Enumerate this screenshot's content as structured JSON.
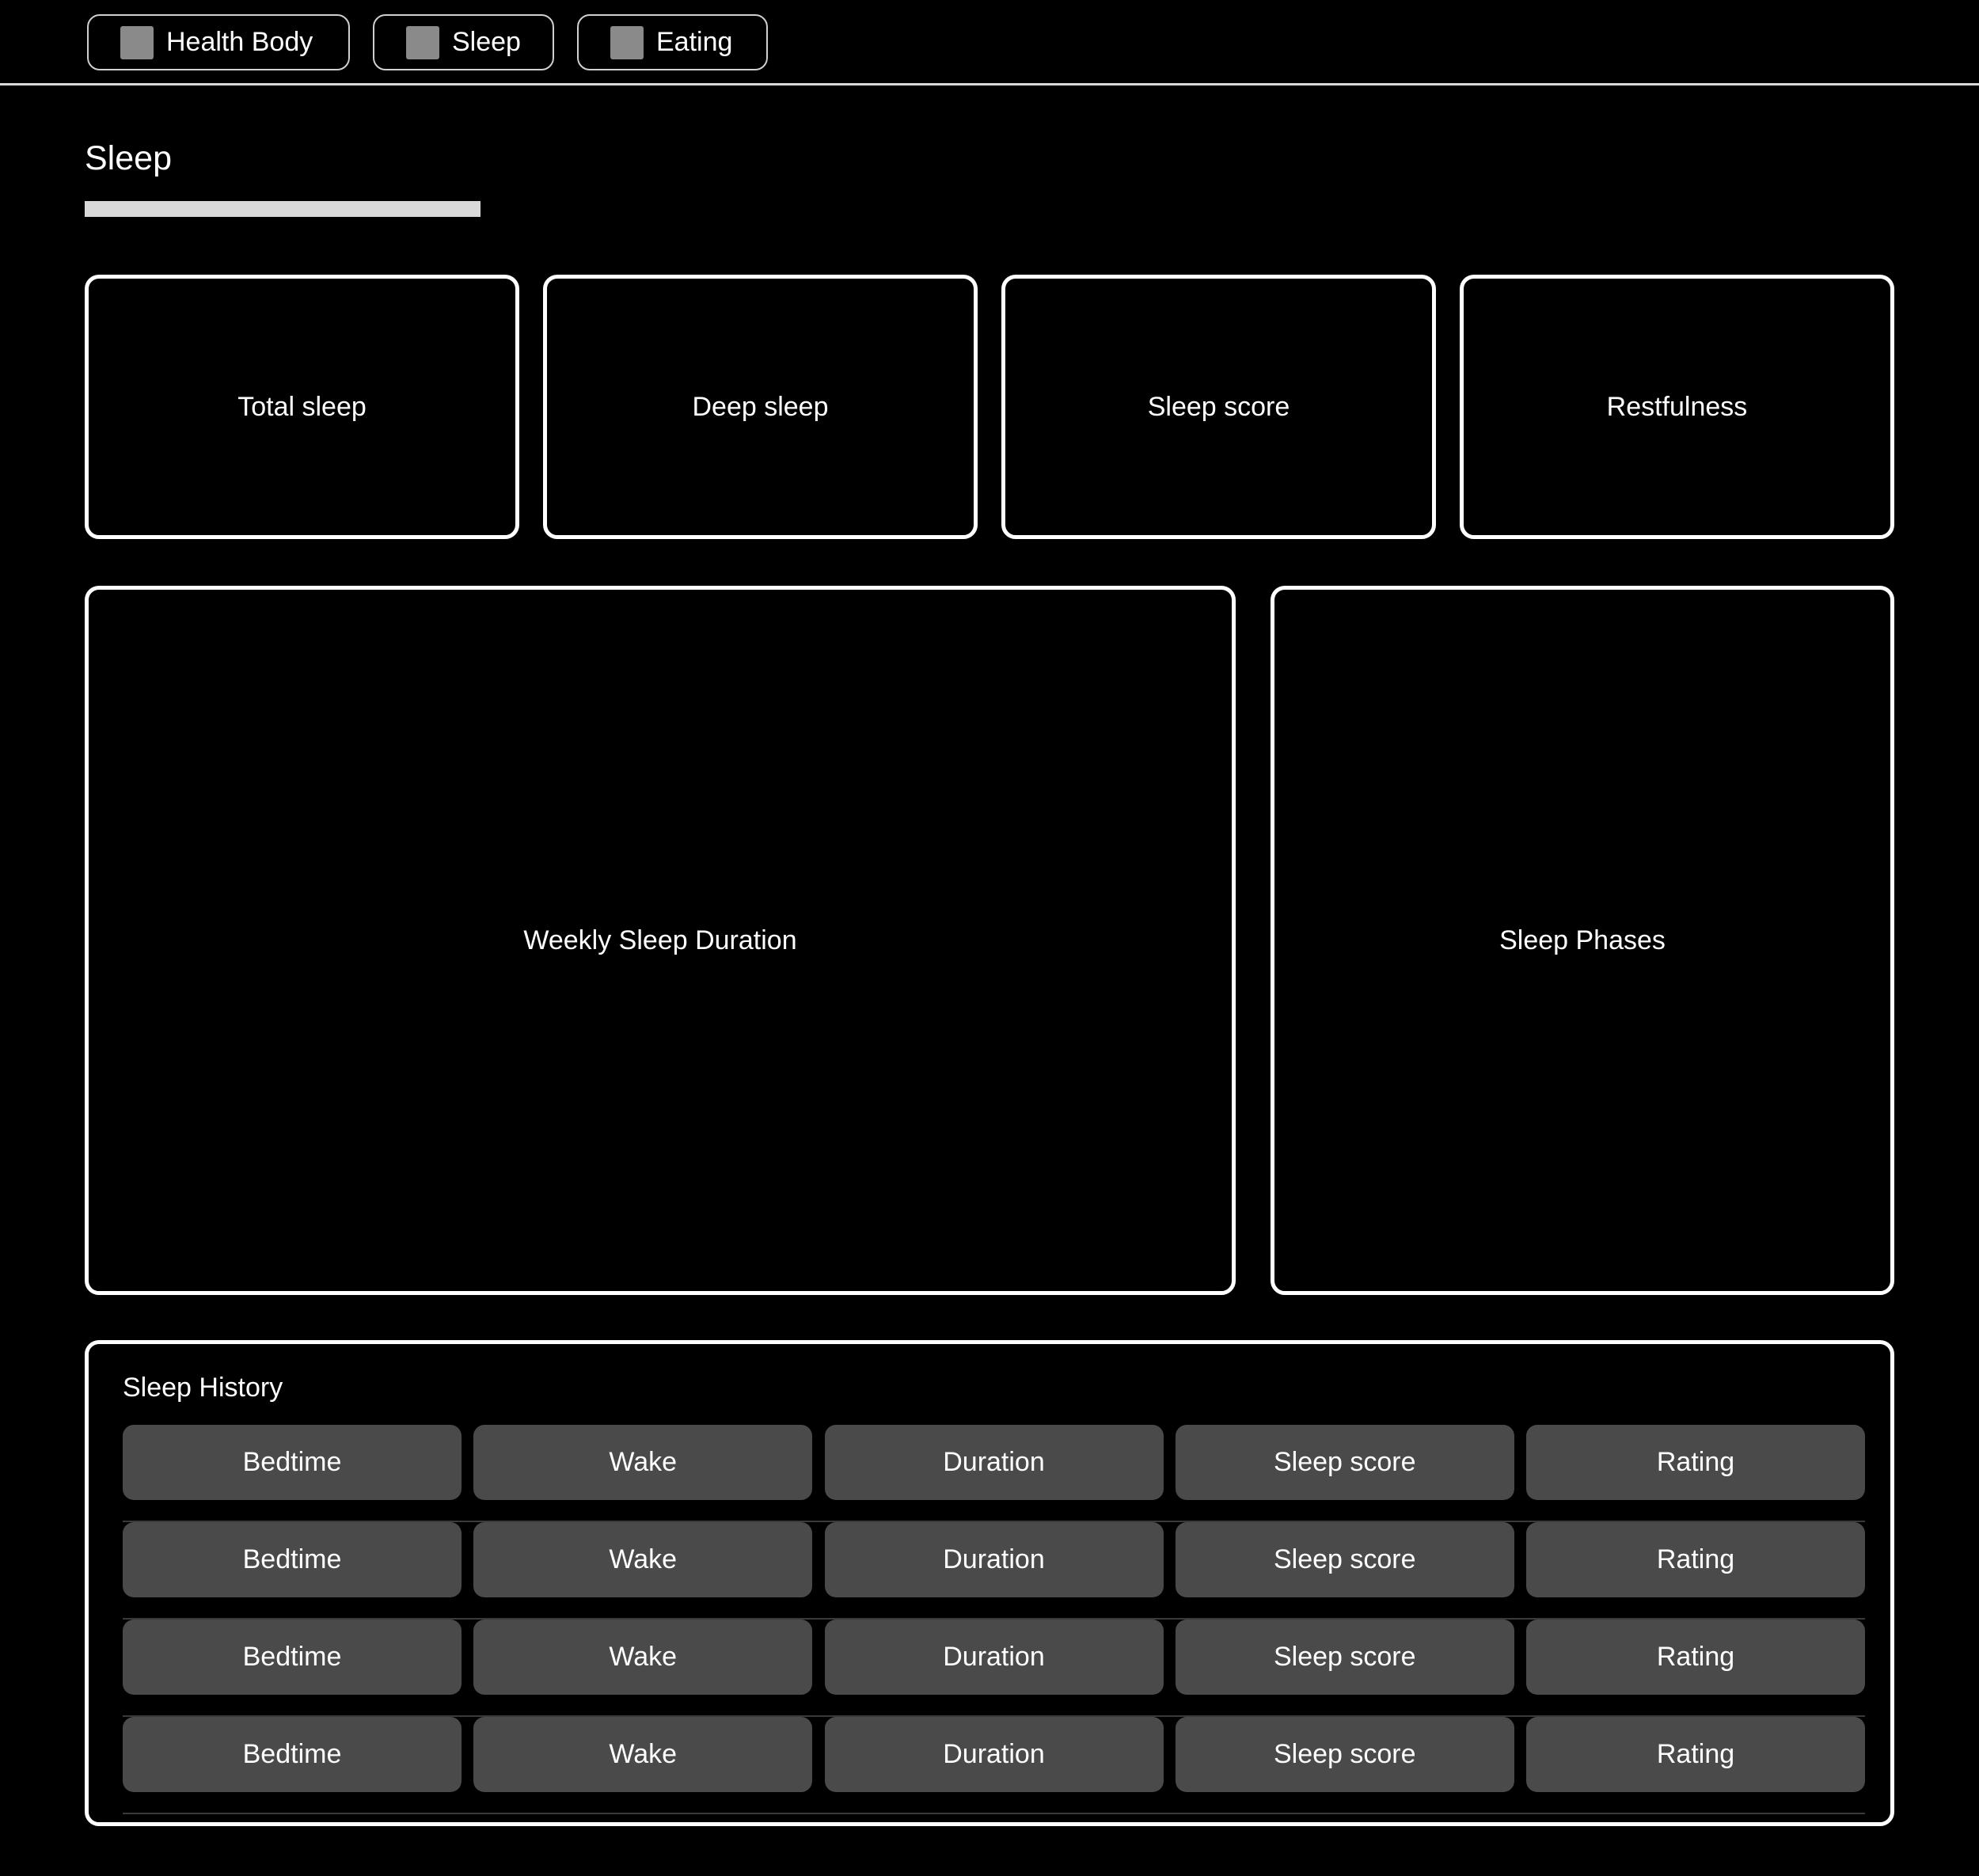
{
  "nav": {
    "tabs": [
      {
        "label": "Health Body",
        "icon": "placeholder-square-icon"
      },
      {
        "label": "Sleep",
        "icon": "placeholder-square-icon"
      },
      {
        "label": "Eating",
        "icon": "placeholder-square-icon"
      }
    ]
  },
  "page": {
    "title": "Sleep"
  },
  "stats": [
    {
      "label": "Total sleep"
    },
    {
      "label": "Deep sleep"
    },
    {
      "label": "Sleep score"
    },
    {
      "label": "Restfulness"
    }
  ],
  "charts": {
    "weekly": {
      "label": "Weekly Sleep Duration"
    },
    "phases": {
      "label": "Sleep Phases"
    }
  },
  "history": {
    "title": "Sleep History",
    "rows": [
      [
        "Bedtime",
        "Wake",
        "Duration",
        "Sleep score",
        "Rating"
      ],
      [
        "Bedtime",
        "Wake",
        "Duration",
        "Sleep score",
        "Rating"
      ],
      [
        "Bedtime",
        "Wake",
        "Duration",
        "Sleep score",
        "Rating"
      ],
      [
        "Bedtime",
        "Wake",
        "Duration",
        "Sleep score",
        "Rating"
      ]
    ]
  },
  "colors": {
    "background": "#000000",
    "border": "#ffffff",
    "cell": "#4a4a4a",
    "icon": "#8a8a8a",
    "underline": "#d9d9d9"
  }
}
